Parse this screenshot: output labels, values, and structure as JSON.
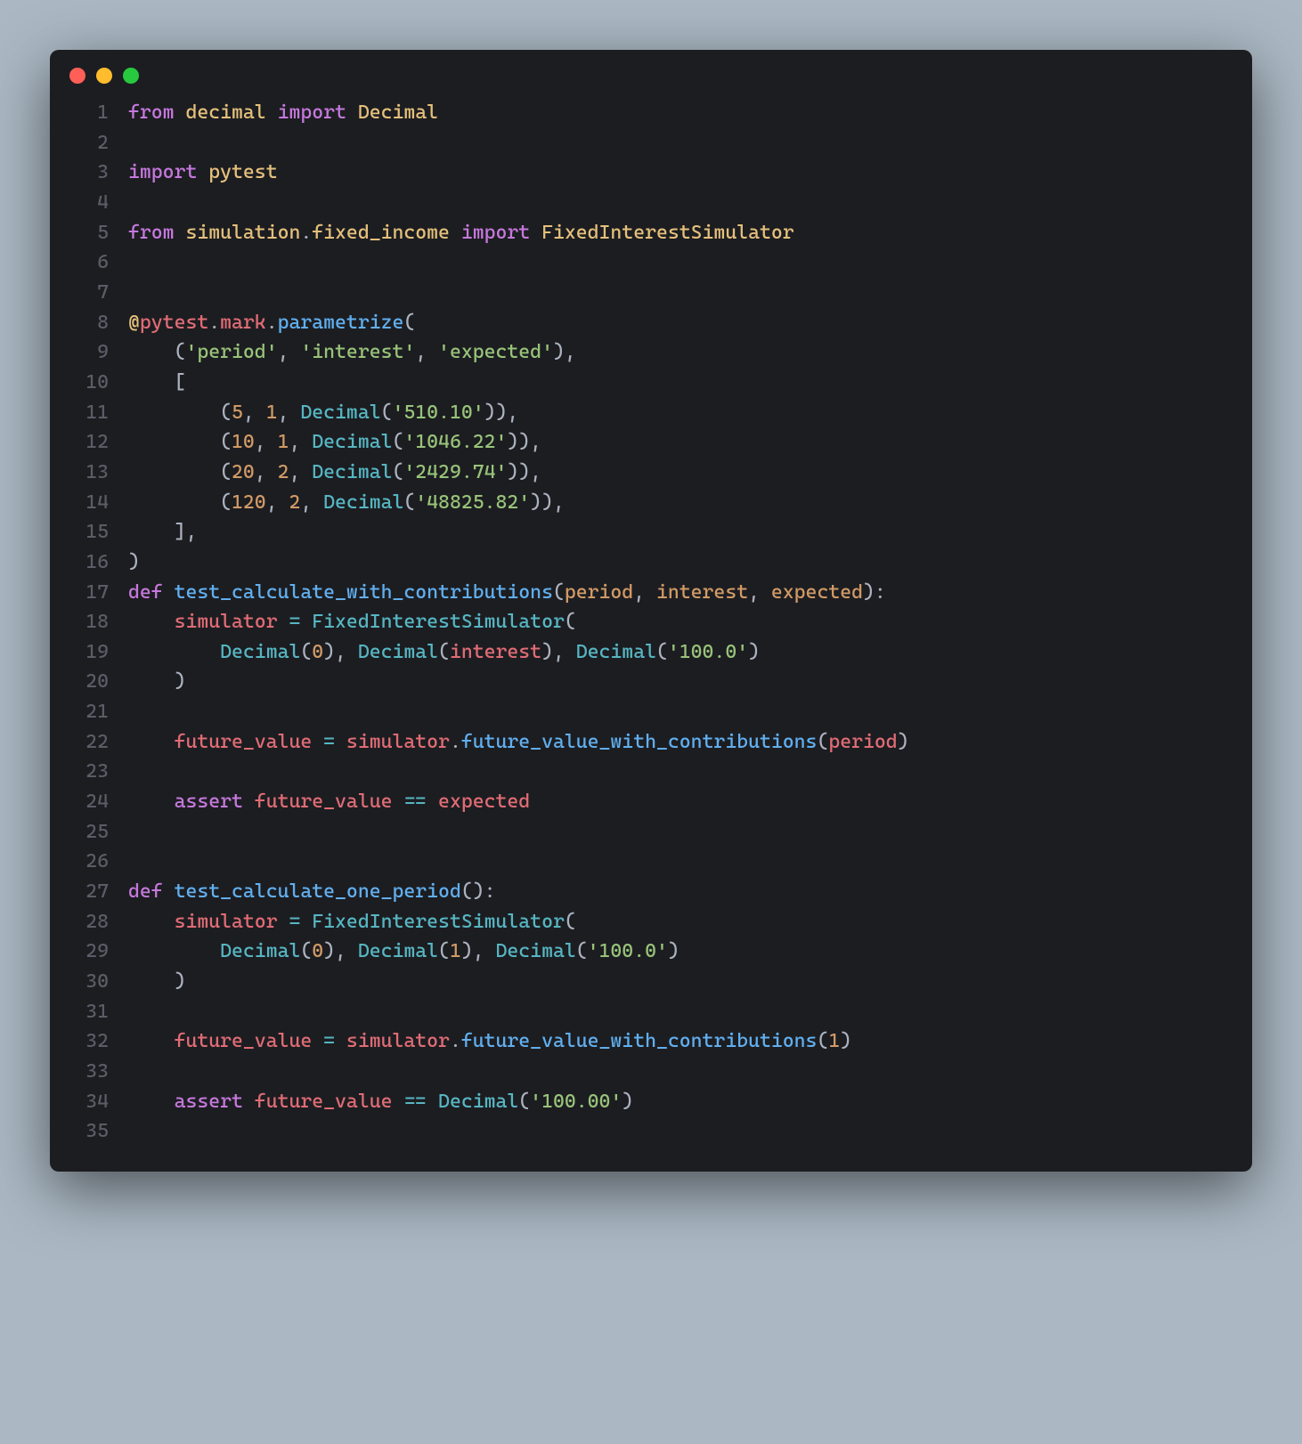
{
  "window": {
    "dots": [
      "red",
      "yellow",
      "green"
    ]
  },
  "lines": {
    "l1_from": "from",
    "l1_decimal": "decimal",
    "l1_import": "import",
    "l1_Decimal": "Decimal",
    "l3_import": "import",
    "l3_pytest": "pytest",
    "l5_from": "from",
    "l5_simulation": "simulation",
    "l5_dot": ".",
    "l5_fixed": "fixed_income",
    "l5_import": "import",
    "l5_FIS": "FixedInterestSimulator",
    "l8_at": "@",
    "l8_pytest": "pytest",
    "l8_mark": "mark",
    "l8_param": "parametrize",
    "l9_period": "'period'",
    "l9_interest": "'interest'",
    "l9_expected": "'expected'",
    "l11_5": "5",
    "l11_1": "1",
    "l11_dec": "Decimal",
    "l11_str": "'510.10'",
    "l12_10": "10",
    "l12_1": "1",
    "l12_dec": "Decimal",
    "l12_str": "'1046.22'",
    "l13_20": "20",
    "l13_2": "2",
    "l13_dec": "Decimal",
    "l13_str": "'2429.74'",
    "l14_120": "120",
    "l14_2": "2",
    "l14_dec": "Decimal",
    "l14_str": "'48825.82'",
    "l17_def": "def",
    "l17_fn": "test_calculate_with_contributions",
    "l17_p1": "period",
    "l17_p2": "interest",
    "l17_p3": "expected",
    "l18_sim": "simulator",
    "l18_eq": "=",
    "l18_FIS": "FixedInterestSimulator",
    "l19_Dec1": "Decimal",
    "l19_0": "0",
    "l19_Dec2": "Decimal",
    "l19_int": "interest",
    "l19_Dec3": "Decimal",
    "l19_str": "'100.0'",
    "l22_fv": "future_value",
    "l22_eq": "=",
    "l22_sim": "simulator",
    "l22_call": "future_value_with_contributions",
    "l22_arg": "period",
    "l24_assert": "assert",
    "l24_fv": "future_value",
    "l24_eq": "==",
    "l24_exp": "expected",
    "l27_def": "def",
    "l27_fn": "test_calculate_one_period",
    "l28_sim": "simulator",
    "l28_eq": "=",
    "l28_FIS": "FixedInterestSimulator",
    "l29_Dec1": "Decimal",
    "l29_0": "0",
    "l29_Dec2": "Decimal",
    "l29_1": "1",
    "l29_Dec3": "Decimal",
    "l29_str": "'100.0'",
    "l32_fv": "future_value",
    "l32_eq": "=",
    "l32_sim": "simulator",
    "l32_call": "future_value_with_contributions",
    "l32_arg": "1",
    "l34_assert": "assert",
    "l34_fv": "future_value",
    "l34_eq": "==",
    "l34_Dec": "Decimal",
    "l34_str": "'100.00'"
  },
  "line_numbers": [
    "1",
    "2",
    "3",
    "4",
    "5",
    "6",
    "7",
    "8",
    "9",
    "10",
    "11",
    "12",
    "13",
    "14",
    "15",
    "16",
    "17",
    "18",
    "19",
    "20",
    "21",
    "22",
    "23",
    "24",
    "25",
    "26",
    "27",
    "28",
    "29",
    "30",
    "31",
    "32",
    "33",
    "34",
    "35"
  ]
}
